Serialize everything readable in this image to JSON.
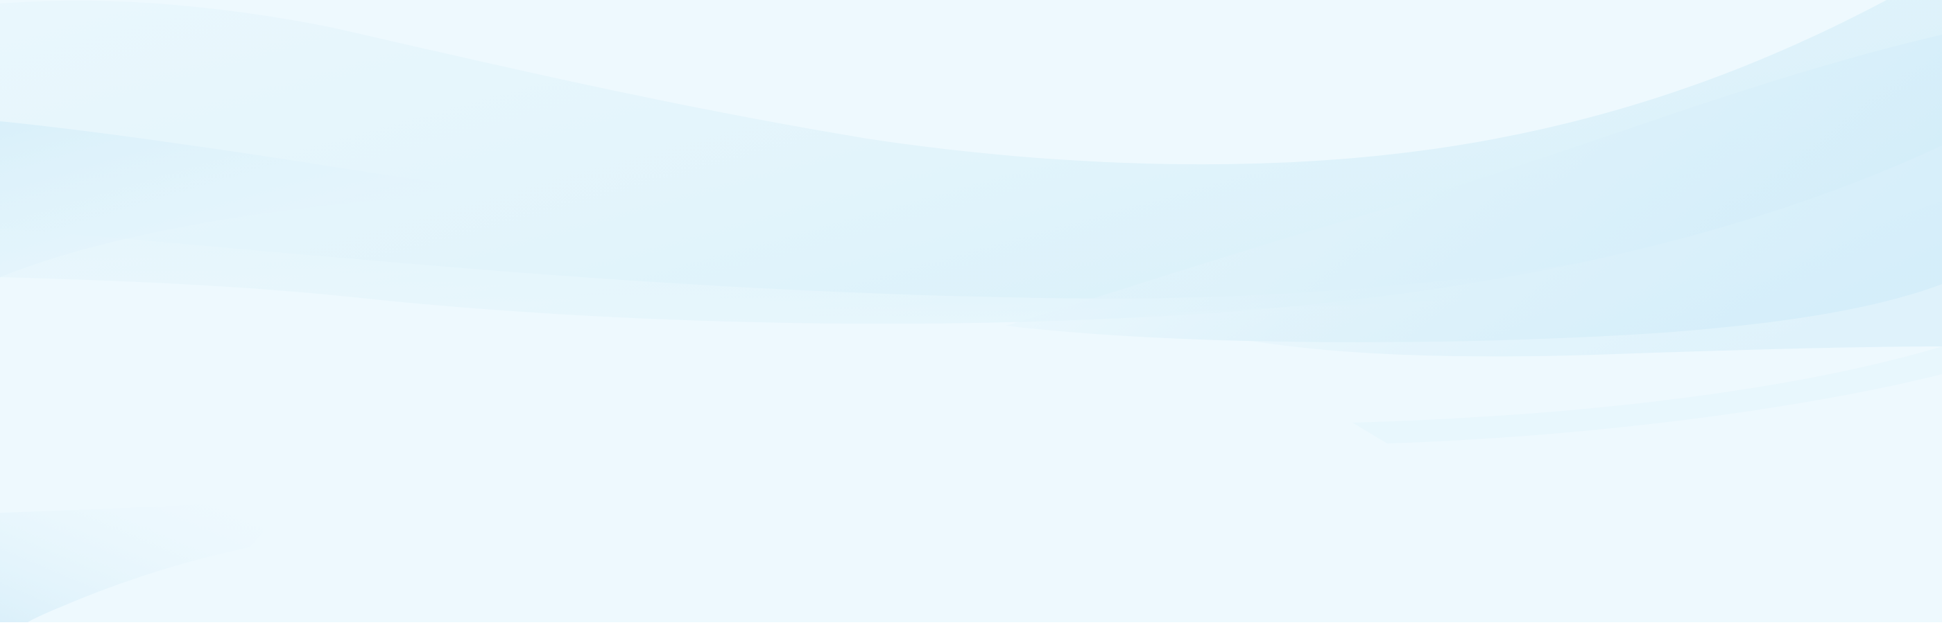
{
  "background": {
    "base_color": "#eef9fe",
    "wave_color_light": "#e6f6fd",
    "wave_color_mid": "#dcf1fa",
    "wave_color_deep": "#d4eef9",
    "bottom_strip_color": "#ffffff"
  }
}
